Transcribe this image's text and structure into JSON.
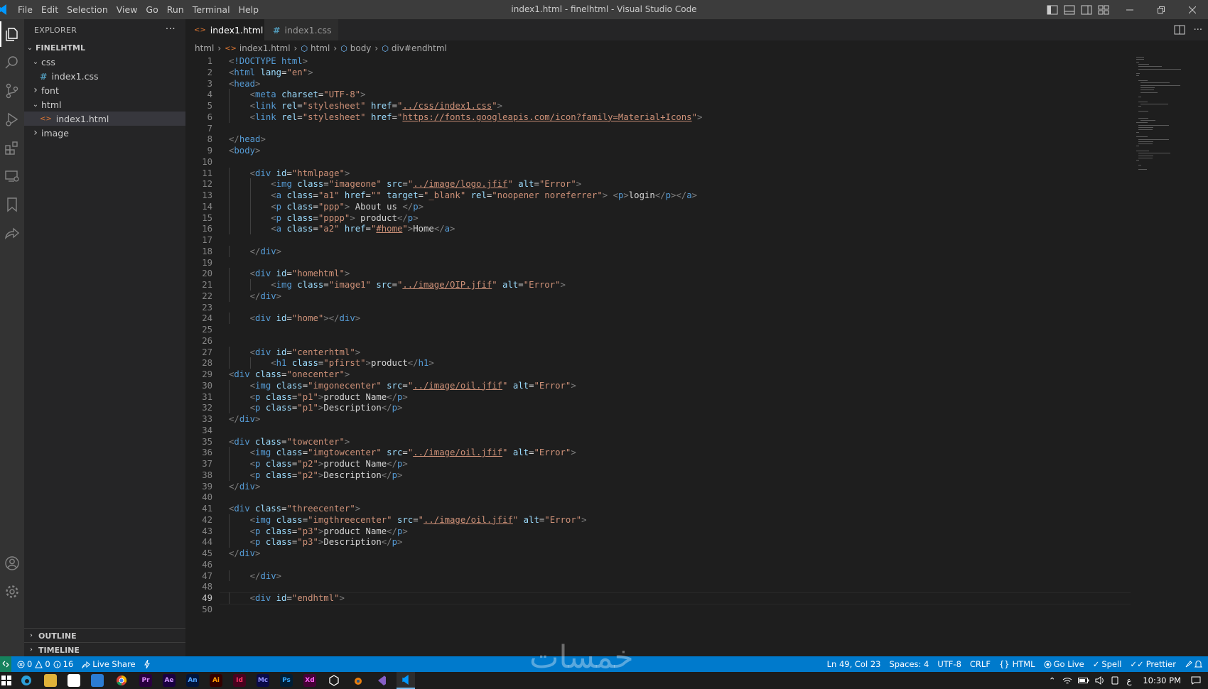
{
  "window": {
    "title": "index1.html - finelhtml - Visual Studio Code",
    "menu": [
      "File",
      "Edit",
      "Selection",
      "View",
      "Go",
      "Run",
      "Terminal",
      "Help"
    ]
  },
  "sidebar": {
    "title": "EXPLORER",
    "more": "···",
    "root": "FINELHTML",
    "tree": [
      {
        "label": "css",
        "type": "folder",
        "open": true,
        "depth": 1
      },
      {
        "label": "index1.css",
        "type": "css",
        "depth": 2
      },
      {
        "label": "font",
        "type": "folder",
        "open": false,
        "depth": 1
      },
      {
        "label": "html",
        "type": "folder",
        "open": true,
        "depth": 1
      },
      {
        "label": "index1.html",
        "type": "html",
        "depth": 2,
        "selected": true
      },
      {
        "label": "image",
        "type": "folder",
        "open": false,
        "depth": 1
      }
    ],
    "outline": "OUTLINE",
    "timeline": "TIMELINE"
  },
  "tabs": [
    {
      "label": "index1.html",
      "active": true,
      "close": "✕"
    },
    {
      "label": "index1.css",
      "active": false
    }
  ],
  "breadcrumb": [
    "html",
    "index1.html",
    "html",
    "body",
    "div#endhtml"
  ],
  "editor": {
    "current_line": 49,
    "lines": [
      "<!DOCTYPE html>",
      "<html lang=\"en\">",
      "<head>",
      "    <meta charset=\"UTF-8\">",
      "    <link rel=\"stylesheet\" href=\"../css/index1.css\">",
      "    <link rel=\"stylesheet\" href=\"https://fonts.googleapis.com/icon?family=Material+Icons\">",
      "",
      "</head>",
      "<body>",
      "",
      "    <div id=\"htmlpage\">",
      "        <img class=\"imageone\" src=\"../image/logo.jfif\" alt=\"Error\">",
      "        <a class=\"a1\" href=\"\" target=\"_blank\" rel=\"noopener noreferrer\"> <p>login</p></a>",
      "        <p class=\"ppp\"> About us </p>",
      "        <p class=\"pppp\"> product</p>",
      "        <a class=\"a2\" href=\"#home\">Home</a>",
      "",
      "    </div>",
      "",
      "    <div id=\"homehtml\">",
      "        <img class=\"image1\" src=\"../image/OIP.jfif\" alt=\"Error\">",
      "    </div>",
      "",
      "    <div id=\"home\"></div>",
      "",
      "",
      "    <div id=\"centerhtml\">",
      "        <h1 class=\"pfirst\">product</h1>",
      "<div class=\"onecenter\">",
      "    <img class=\"imgonecenter\" src=\"../image/oil.jfif\" alt=\"Error\">",
      "    <p class=\"p1\">product Name</p>",
      "    <p class=\"p1\">Description</p>",
      "</div>",
      "",
      "<div class=\"towcenter\">",
      "    <img class=\"imgtowcenter\" src=\"../image/oil.jfif\" alt=\"Error\">",
      "    <p class=\"p2\">product Name</p>",
      "    <p class=\"p2\">Description</p>",
      "</div>",
      "",
      "<div class=\"threecenter\">",
      "    <img class=\"imgthreecenter\" src=\"../image/oil.jfif\" alt=\"Error\">",
      "    <p class=\"p3\">product Name</p>",
      "    <p class=\"p3\">Description</p>",
      "</div>",
      "",
      "    </div>",
      "",
      "    <div id=\"endhtml\">",
      ""
    ]
  },
  "statusbar": {
    "errors": "0",
    "warnings": "0",
    "infos": "16",
    "live_share": "Live Share",
    "position": "Ln 49, Col 23",
    "spaces": "Spaces: 4",
    "encoding": "UTF-8",
    "eol": "CRLF",
    "language": "HTML",
    "go_live": "Go Live",
    "spell": "Spell",
    "prettier": "Prettier"
  },
  "watermark": "خمسات",
  "taskbar": {
    "apps": [
      "Pr",
      "Ae",
      "An",
      "Ai",
      "Id",
      "Mc",
      "Ps",
      "Xd"
    ],
    "lang": "ع",
    "time": "10:30 PM"
  },
  "colors": {
    "accent": "#007acc",
    "tag": "#569cd6",
    "attr": "#9cdcfe",
    "value": "#ce9178"
  }
}
